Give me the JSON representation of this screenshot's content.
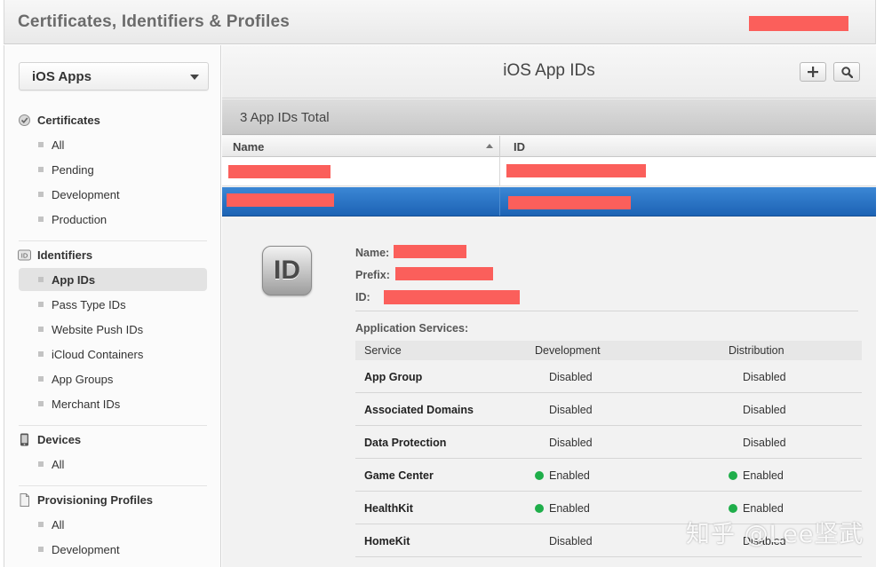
{
  "header": {
    "title": "Certificates, Identifiers & Profiles"
  },
  "sidebar": {
    "platform_select": {
      "value": "iOS Apps",
      "caret_icon": "chevron-down-icon"
    },
    "sections": [
      {
        "title": "Certificates",
        "icon": "certificate-icon",
        "items": [
          "All",
          "Pending",
          "Development",
          "Production"
        ]
      },
      {
        "title": "Identifiers",
        "icon": "id-icon",
        "items": [
          "App IDs",
          "Pass Type IDs",
          "Website Push IDs",
          "iCloud Containers",
          "App Groups",
          "Merchant IDs"
        ]
      },
      {
        "title": "Devices",
        "icon": "device-icon",
        "items": [
          "All"
        ]
      },
      {
        "title": "Provisioning Profiles",
        "icon": "document-icon",
        "items": [
          "All",
          "Development"
        ]
      }
    ],
    "active_item": "App IDs"
  },
  "main": {
    "title": "iOS App IDs",
    "toolbar": {
      "add_icon": "plus-icon",
      "search_icon": "search-icon"
    },
    "count_text": "3 App IDs Total",
    "columns": [
      "Name",
      "ID"
    ],
    "detail": {
      "badge_text": "ID",
      "name_label": "Name:",
      "prefix_label": "Prefix:",
      "id_label": "ID:",
      "services_title": "Application Services:",
      "service_columns": [
        "Service",
        "Development",
        "Distribution"
      ],
      "services": [
        {
          "name": "App Group",
          "development": "Disabled",
          "distribution": "Disabled"
        },
        {
          "name": "Associated Domains",
          "development": "Disabled",
          "distribution": "Disabled"
        },
        {
          "name": "Data Protection",
          "development": "Disabled",
          "distribution": "Disabled"
        },
        {
          "name": "Game Center",
          "development": "Enabled",
          "distribution": "Enabled"
        },
        {
          "name": "HealthKit",
          "development": "Enabled",
          "distribution": "Enabled"
        },
        {
          "name": "HomeKit",
          "development": "Disabled",
          "distribution": "Disabled"
        }
      ]
    }
  },
  "colors": {
    "selected_row": "#1d63b4",
    "enabled_dot": "#1fae4a",
    "redaction": "#fb5f5b"
  },
  "watermark": "知乎 @Lee坚武"
}
